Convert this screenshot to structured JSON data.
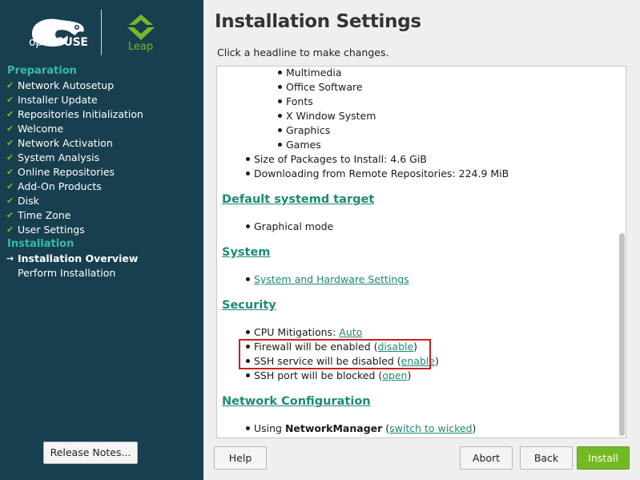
{
  "brand": {
    "opensuse_prefix": "open",
    "opensuse_suffix": "SUSE",
    "leap": "Leap",
    "colors": {
      "sidebar": "#173f4f",
      "accent": "#73ba25",
      "section": "#35b9ab",
      "link": "#1d8a73",
      "highlight": "#d21e1e"
    }
  },
  "sidebar": {
    "sections": [
      {
        "title": "Preparation",
        "steps": [
          {
            "label": "Network Autosetup",
            "state": "done"
          },
          {
            "label": "Installer Update",
            "state": "done"
          },
          {
            "label": "Repositories Initialization",
            "state": "done"
          },
          {
            "label": "Welcome",
            "state": "done"
          },
          {
            "label": "Network Activation",
            "state": "done"
          },
          {
            "label": "System Analysis",
            "state": "done"
          },
          {
            "label": "Online Repositories",
            "state": "done"
          },
          {
            "label": "Add-On Products",
            "state": "done"
          },
          {
            "label": "Disk",
            "state": "done"
          },
          {
            "label": "Time Zone",
            "state": "done"
          },
          {
            "label": "User Settings",
            "state": "done"
          }
        ]
      },
      {
        "title": "Installation",
        "steps": [
          {
            "label": "Installation Overview",
            "state": "current"
          },
          {
            "label": "Perform Installation",
            "state": "pending"
          }
        ]
      }
    ],
    "release_notes": "Release Notes..."
  },
  "main": {
    "title": "Installation Settings",
    "subtitle": "Click a headline to make changes.",
    "software_patterns": [
      "Multimedia",
      "Office Software",
      "Fonts",
      "X Window System",
      "Graphics",
      "Games"
    ],
    "package_size": "Size of Packages to Install: 4.6 GiB",
    "download": "Downloading from Remote Repositories: 224.9 MiB",
    "systemd_heading": "Default systemd target",
    "systemd_value": "Graphical mode",
    "system_heading": "System",
    "system_link": "System and Hardware Settings",
    "security_heading": "Security",
    "cpu_label": "CPU Mitigations: ",
    "cpu_link": "Auto",
    "firewall_label": "Firewall will be enabled (",
    "firewall_link": "disable",
    "ssh_label": "SSH service will be disabled (",
    "ssh_link": "enable",
    "sshport_label": "SSH port will be blocked (",
    "sshport_link": "open",
    "close_paren": ")",
    "network_heading": "Network Configuration",
    "network_using": "Using ",
    "network_manager": "NetworkManager",
    "network_open_paren": " (",
    "network_link": "switch to wicked"
  },
  "buttons": {
    "help": "Help",
    "abort": "Abort",
    "back": "Back",
    "install": "Install"
  }
}
